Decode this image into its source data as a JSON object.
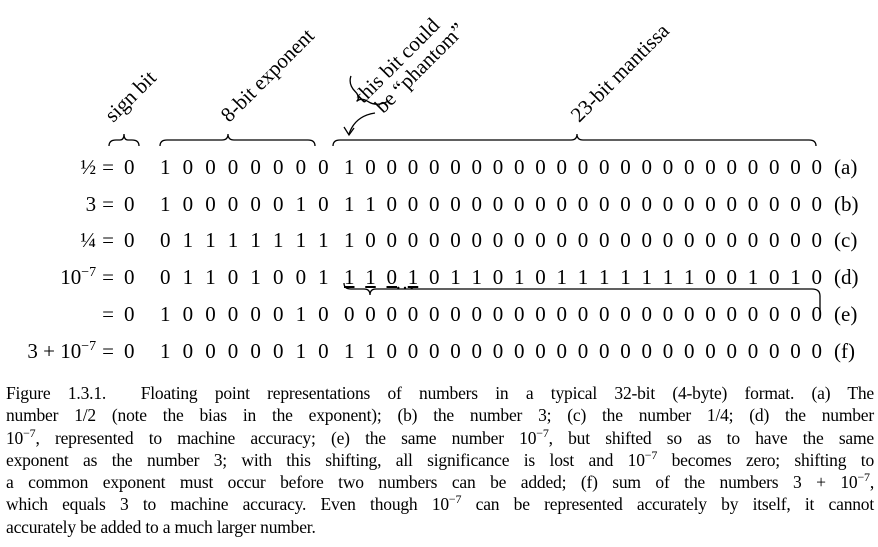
{
  "labels": {
    "sign": "sign bit",
    "exponent": "8-bit exponent",
    "phantom_line1": "this bit could",
    "phantom_line2": "be “phantom”",
    "mantissa": "23-bit mantissa"
  },
  "rows": [
    {
      "label": "½",
      "sup": "",
      "sign": "0",
      "exponent": "10000000",
      "mantissa": "10000000000000000000000",
      "tag": "(a)"
    },
    {
      "label": "3",
      "sup": "",
      "sign": "0",
      "exponent": "10000010",
      "mantissa": "11000000000000000000000",
      "tag": "(b)"
    },
    {
      "label": "¼",
      "sup": "",
      "sign": "0",
      "exponent": "01111111",
      "mantissa": "10000000000000000000000",
      "tag": "(c)"
    },
    {
      "label": "10",
      "sup": "−7",
      "sign": "0",
      "exponent": "01101001",
      "mantissa": "11010110101111111001010",
      "tag": "(d)"
    },
    {
      "label": "",
      "sup": "",
      "sign": "0",
      "exponent": "10000010",
      "mantissa": "00000000000000000000000",
      "tag": "(e)"
    },
    {
      "label": "3 + 10",
      "sup": "−7",
      "sign": "0",
      "exponent": "10000010",
      "mantissa": "11000000000000000000000",
      "tag": "(f)"
    }
  ],
  "equals": "=",
  "ellipsis": "…",
  "caption": [
    [
      {
        "t": "Figure 1.3.1.  Floating point representations of numbers in a typical 32-bit (4-byte) format.  (a) The"
      }
    ],
    [
      {
        "t": "number 1/2 (note the bias in the exponent); (b) the number 3; (c) the number 1/4; (d) the number"
      }
    ],
    [
      {
        "t": "10"
      },
      {
        "t": "−7",
        "sup": true
      },
      {
        "t": ", represented to machine accuracy; (e) the same number 10"
      },
      {
        "t": "−7",
        "sup": true
      },
      {
        "t": ", but shifted so as to have the same"
      }
    ],
    [
      {
        "t": "exponent as the number 3; with this shifting, all significance is lost and 10"
      },
      {
        "t": "−7",
        "sup": true
      },
      {
        "t": " becomes zero; shifting to"
      }
    ],
    [
      {
        "t": "a common exponent must occur before two numbers can be added; (f) sum of the numbers 3 + 10"
      },
      {
        "t": "−7",
        "sup": true
      },
      {
        "t": ","
      }
    ],
    [
      {
        "t": "which equals 3 to machine accuracy. Even though 10"
      },
      {
        "t": "−7",
        "sup": true
      },
      {
        "t": " can be represented accurately by itself, it cannot"
      }
    ],
    [
      {
        "t": "accurately be added to a much larger number."
      }
    ]
  ]
}
